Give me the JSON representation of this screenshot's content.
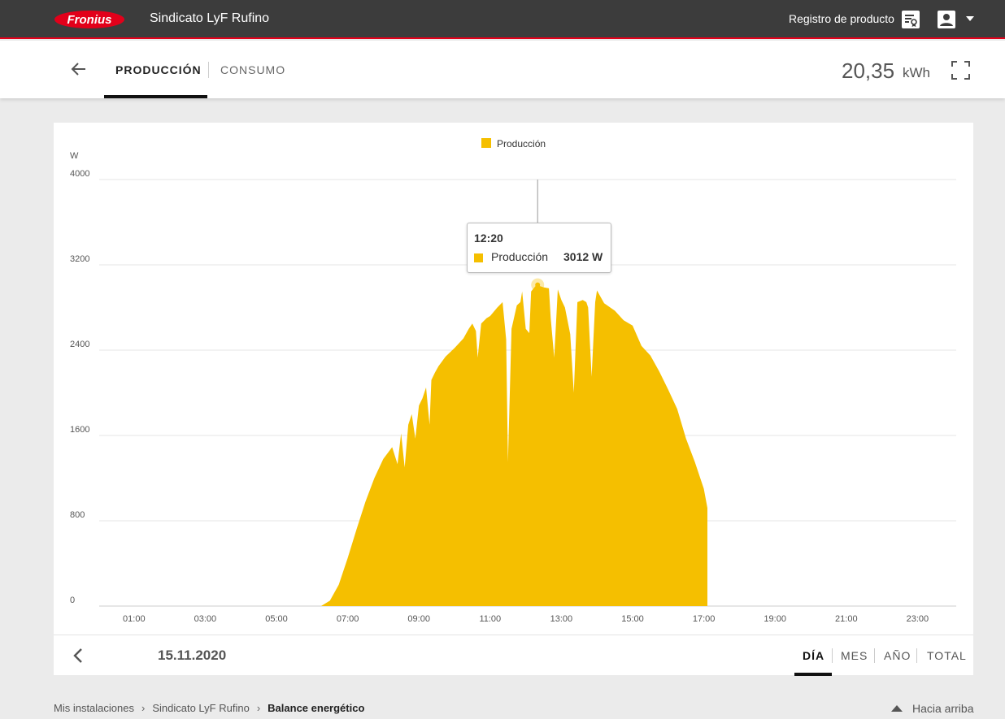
{
  "header": {
    "logo_text": "Fronius",
    "site_name": "Sindicato LyF Rufino",
    "product_registration": "Registro de producto",
    "icons": [
      "product-registration-icon",
      "user-account-icon",
      "caret-down-icon"
    ]
  },
  "subheader": {
    "tabs": [
      {
        "label": "PRODUCCIÓN",
        "active": true
      },
      {
        "label": "CONSUMO",
        "active": false
      }
    ],
    "energy_value": "20,35",
    "energy_unit": "kWh"
  },
  "chart_data": {
    "type": "area",
    "legend": [
      "Producción"
    ],
    "ylabel": "W",
    "ylim": [
      0,
      4000
    ],
    "y_ticks": [
      "0",
      "800",
      "1600",
      "2400",
      "3200",
      "4000"
    ],
    "x_ticks": [
      "01:00",
      "03:00",
      "05:00",
      "07:00",
      "09:00",
      "11:00",
      "13:00",
      "15:00",
      "17:00",
      "19:00",
      "21:00",
      "23:00"
    ],
    "xlim_hours": [
      0,
      24
    ],
    "series": [
      {
        "name": "Producción",
        "color": "#f5bf00",
        "points": [
          [
            6.25,
            0
          ],
          [
            6.5,
            50
          ],
          [
            6.75,
            200
          ],
          [
            7,
            450
          ],
          [
            7.25,
            720
          ],
          [
            7.5,
            980
          ],
          [
            7.75,
            1200
          ],
          [
            8,
            1380
          ],
          [
            8.25,
            1490
          ],
          [
            8.4,
            1330
          ],
          [
            8.5,
            1620
          ],
          [
            8.6,
            1300
          ],
          [
            8.7,
            1700
          ],
          [
            8.8,
            1800
          ],
          [
            8.9,
            1570
          ],
          [
            9,
            1880
          ],
          [
            9.1,
            1950
          ],
          [
            9.2,
            2050
          ],
          [
            9.3,
            1700
          ],
          [
            9.35,
            2120
          ],
          [
            9.45,
            2190
          ],
          [
            9.55,
            2250
          ],
          [
            9.75,
            2340
          ],
          [
            10,
            2420
          ],
          [
            10.25,
            2510
          ],
          [
            10.4,
            2600
          ],
          [
            10.5,
            2650
          ],
          [
            10.6,
            2580
          ],
          [
            10.65,
            2330
          ],
          [
            10.75,
            2650
          ],
          [
            10.9,
            2700
          ],
          [
            11,
            2720
          ],
          [
            11.2,
            2800
          ],
          [
            11.35,
            2850
          ],
          [
            11.45,
            2500
          ],
          [
            11.5,
            1350
          ],
          [
            11.6,
            2600
          ],
          [
            11.75,
            2820
          ],
          [
            11.85,
            2850
          ],
          [
            11.9,
            2950
          ],
          [
            12,
            2600
          ],
          [
            12.1,
            2560
          ],
          [
            12.15,
            2950
          ],
          [
            12.3,
            3012
          ],
          [
            12.5,
            2990
          ],
          [
            12.65,
            2980
          ],
          [
            12.7,
            2700
          ],
          [
            12.8,
            2330
          ],
          [
            12.9,
            2970
          ],
          [
            13,
            2870
          ],
          [
            13.1,
            2800
          ],
          [
            13.25,
            2550
          ],
          [
            13.35,
            2000
          ],
          [
            13.45,
            2850
          ],
          [
            13.6,
            2870
          ],
          [
            13.7,
            2850
          ],
          [
            13.75,
            2800
          ],
          [
            13.85,
            2150
          ],
          [
            13.95,
            2850
          ],
          [
            14,
            2960
          ],
          [
            14.2,
            2840
          ],
          [
            14.5,
            2770
          ],
          [
            14.75,
            2680
          ],
          [
            15,
            2630
          ],
          [
            15.25,
            2440
          ],
          [
            15.5,
            2350
          ],
          [
            15.75,
            2200
          ],
          [
            16,
            2030
          ],
          [
            16.25,
            1850
          ],
          [
            16.5,
            1570
          ],
          [
            16.75,
            1350
          ],
          [
            17,
            1100
          ],
          [
            17.1,
            920
          ],
          [
            17.1,
            0
          ]
        ]
      }
    ]
  },
  "tooltip": {
    "time": "12:20",
    "series": "Producción",
    "value": "3012 W"
  },
  "footer": {
    "date": "15.11.2020",
    "periods": [
      {
        "label": "DÍA",
        "active": true
      },
      {
        "label": "MES",
        "active": false
      },
      {
        "label": "AÑO",
        "active": false
      },
      {
        "label": "TOTAL",
        "active": false
      }
    ]
  },
  "breadcrumb": {
    "items": [
      "Mis instalaciones",
      "Sindicato LyF Rufino",
      "Balance energético"
    ],
    "separator": "›"
  },
  "back_to_top": "Hacia arriba"
}
